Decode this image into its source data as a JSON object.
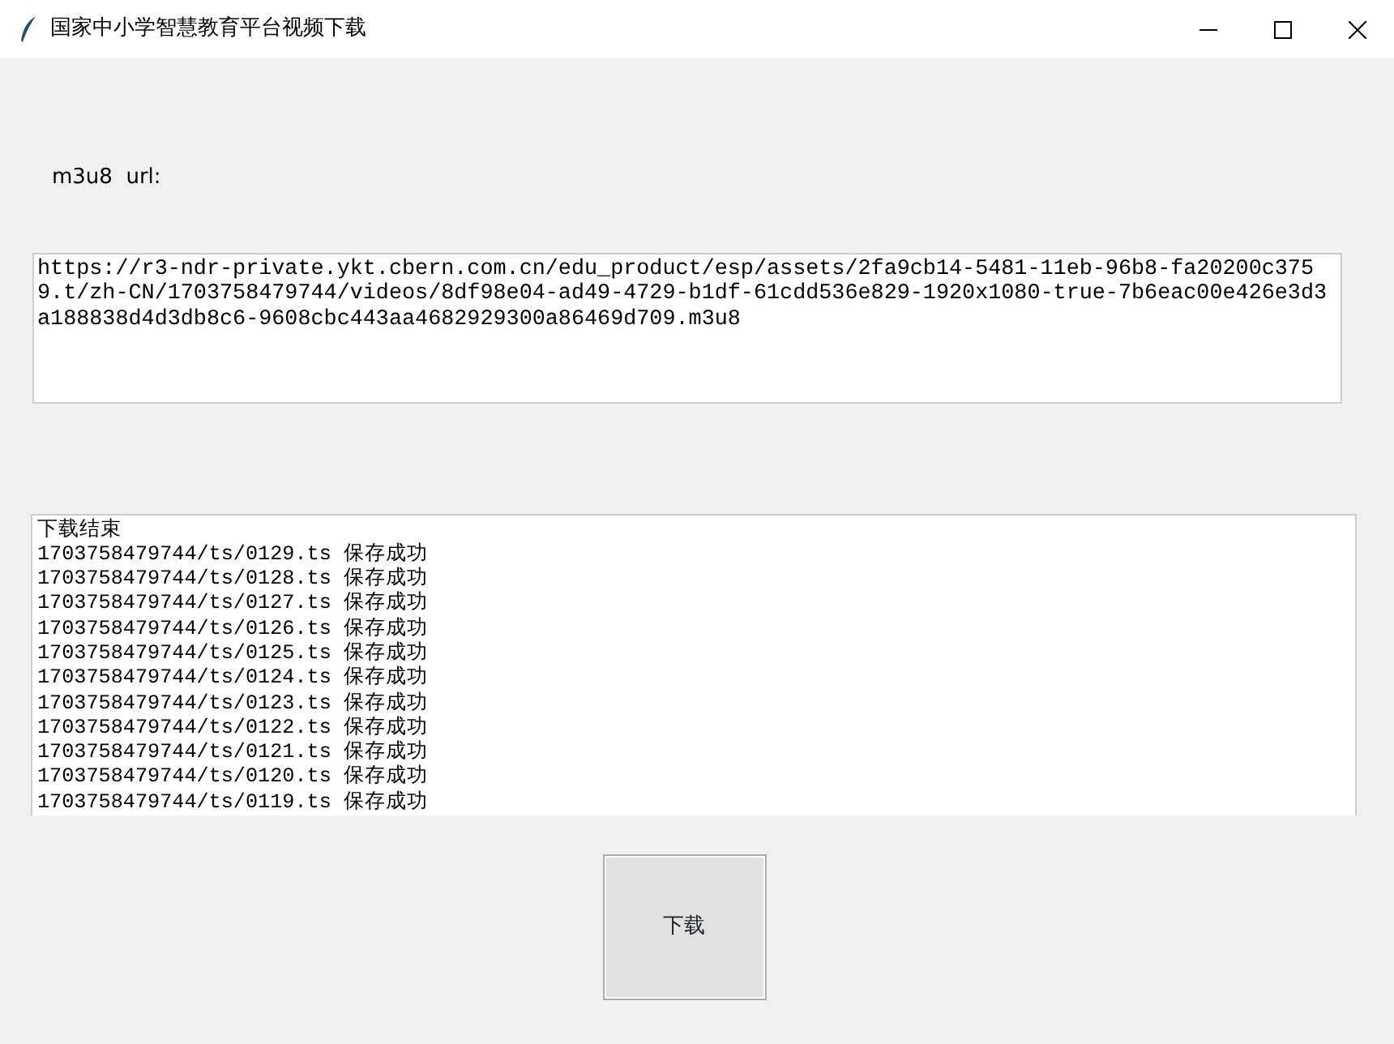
{
  "window": {
    "title": "国家中小学智慧教育平台视频下载"
  },
  "url_label": "m3u8  url:",
  "url_field": {
    "value": "https://r3-ndr-private.ykt.cbern.com.cn/edu_product/esp/assets/2fa9cb14-5481-11eb-96b8-fa20200c3759.t/zh-CN/1703758479744/videos/8df98e04-ad49-4729-b1df-61cdd536e829-1920x1080-true-7b6eac00e426e3d3a188838d4d3db8c6-9608cbc443aa4682929300a86469d709.m3u8"
  },
  "log": [
    "下载结束",
    "1703758479744/ts/0129.ts 保存成功",
    "1703758479744/ts/0128.ts 保存成功",
    "1703758479744/ts/0127.ts 保存成功",
    "1703758479744/ts/0126.ts 保存成功",
    "1703758479744/ts/0125.ts 保存成功",
    "1703758479744/ts/0124.ts 保存成功",
    "1703758479744/ts/0123.ts 保存成功",
    "1703758479744/ts/0122.ts 保存成功",
    "1703758479744/ts/0121.ts 保存成功",
    "1703758479744/ts/0120.ts 保存成功",
    "1703758479744/ts/0119.ts 保存成功"
  ],
  "buttons": [
    "下载"
  ]
}
